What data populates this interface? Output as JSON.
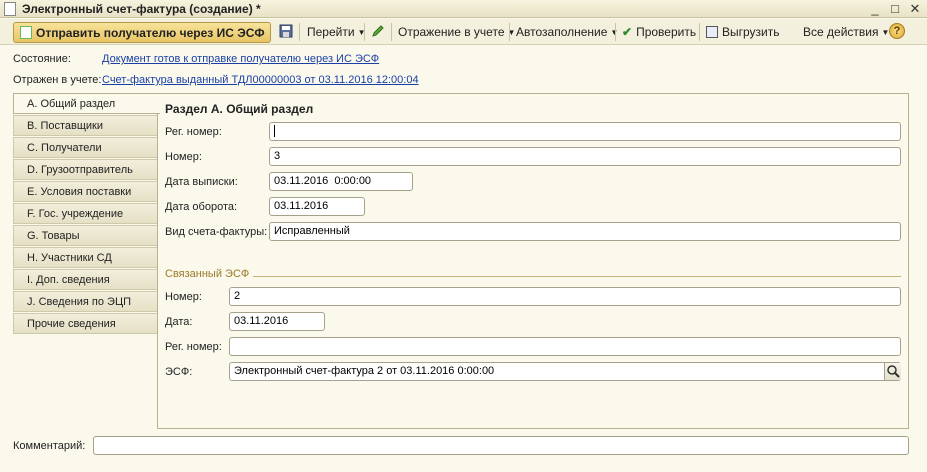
{
  "window": {
    "title": "Электронный счет-фактура (создание) *",
    "controls": {
      "minimize": "_",
      "maximize": "□",
      "close": "✕"
    }
  },
  "toolbar": {
    "primary_label": "Отправить получателю через ИС ЭСФ",
    "goto_label": "Перейти",
    "reflect_label": "Отражение в учете",
    "autofill_label": "Автозаполнение",
    "check_label": "Проверить",
    "export_label": "Выгрузить",
    "all_actions_label": "Все действия",
    "help_label": "?"
  },
  "header": {
    "state_label": "Состояние:",
    "state_value": "Документ готов к отправке получателю через ИС ЭСФ",
    "reflected_label": "Отражен в учете:",
    "reflected_value": "Счет-фактура выданный ТДЛ00000003 от 03.11.2016 12:00:04"
  },
  "tabs": [
    {
      "label": "A. Общий раздел",
      "active": true
    },
    {
      "label": "B. Поставщики"
    },
    {
      "label": "C. Получатели"
    },
    {
      "label": "D. Грузоотправитель"
    },
    {
      "label": "E. Условия поставки"
    },
    {
      "label": "F. Гос. учреждение"
    },
    {
      "label": "G. Товары"
    },
    {
      "label": "H. Участники СД"
    },
    {
      "label": "I. Доп. сведения"
    },
    {
      "label": "J. Сведения по ЭЦП"
    },
    {
      "label": "Прочие сведения"
    }
  ],
  "section": {
    "title": "Раздел А. Общий раздел",
    "reg_number_label": "Рег. номер:",
    "reg_number_value": "",
    "number_label": "Номер:",
    "number_value": "3",
    "issue_date_label": "Дата выписки:",
    "issue_date_value": "03.11.2016  0:00:00",
    "turnover_date_label": "Дата оборота:",
    "turnover_date_value": "03.11.2016",
    "invoice_type_label": "Вид счета-фактуры:",
    "invoice_type_value": "Исправленный"
  },
  "related": {
    "group_title": "Связанный ЭСФ",
    "number_label": "Номер:",
    "number_value": "2",
    "date_label": "Дата:",
    "date_value": "03.11.2016",
    "reg_number_label": "Рег. номер:",
    "reg_number_value": "",
    "esf_label": "ЭСФ:",
    "esf_value": "Электронный счет-фактура 2 от 03.11.2016 0:00:00"
  },
  "footer": {
    "comment_label": "Комментарий:",
    "comment_value": ""
  },
  "icons": {
    "doc": "document-icon",
    "save": "save-icon",
    "pencil": "pencil-icon",
    "check": "checkmark-icon",
    "export": "export-icon",
    "search": "search-icon"
  }
}
